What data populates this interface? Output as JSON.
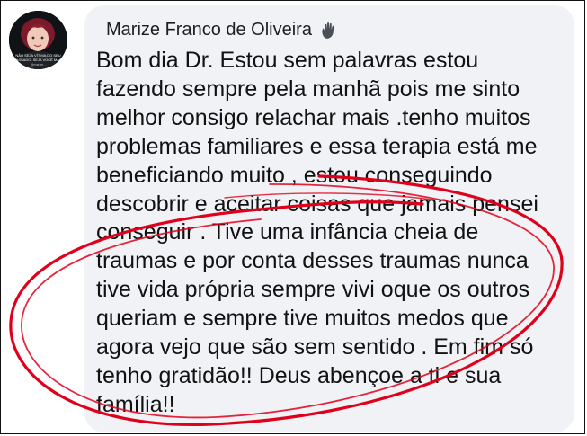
{
  "comment": {
    "author_name": "Marize Franco de Oliveira",
    "author_badge_icon": "waving-hand-icon",
    "avatar": {
      "caption_lines": [
        "NÃO SEJA VÍTIMA DO SEU",
        "PASSADO, SEJA VOCÊ MAIS",
        "@marize..."
      ]
    },
    "message_lines": [
      "Bom dia Dr. Estou sem palavras estou",
      "fazendo sempre pela manhã pois me sinto",
      "melhor consigo relachar mais .tenho muitos",
      "problemas familiares e essa terapia está me",
      "beneficiando muito , estou conseguindo",
      "descobrir e aceitar coisas que jamais pensei",
      "conseguir . Tive uma infância cheia de",
      "traumas e por conta desses traumas nunca",
      "tive vida própria sempre vivi oque os outros",
      "queriam e sempre tive muitos medos que",
      "agora vejo que são sem sentido . Em fim só",
      "tenho gratidão!! Deus abençoe a ti e sua",
      "família!!"
    ]
  },
  "annotation": {
    "shape": "hand-drawn-ellipse",
    "color": "#e0001b"
  },
  "colors": {
    "bubble_bg": "#f0f2f5",
    "text": "#121212",
    "frame_border": "#111111"
  }
}
